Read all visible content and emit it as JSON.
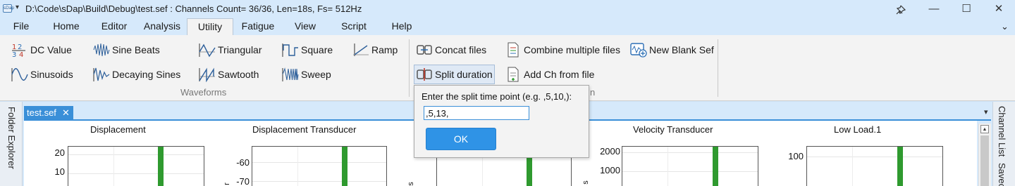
{
  "window": {
    "title": "D:\\Code\\sDap\\Build\\Debug\\test.sef : Channels Count= 36/36, Len=18s, Fs= 512Hz",
    "app_icon_text": "sDap",
    "menu_arrow": "▾",
    "pin_glyph": "⊥",
    "minimize_glyph": "—",
    "maximize_glyph": "☐",
    "close_glyph": "✕"
  },
  "menu": {
    "tabs": [
      {
        "label": "File"
      },
      {
        "label": "Home"
      },
      {
        "label": "Editor"
      },
      {
        "label": "Analysis"
      },
      {
        "label": "Utility",
        "active": true
      },
      {
        "label": "Fatigue"
      },
      {
        "label": "View"
      },
      {
        "label": "Script"
      },
      {
        "label": "Help"
      }
    ],
    "collapse_glyph": "⌄"
  },
  "ribbon": {
    "waveforms": {
      "group_label": "Waveforms",
      "items": [
        {
          "label": "DC Value",
          "icon": "fraction-icon"
        },
        {
          "label": "Sine Beats",
          "icon": "sine-beats-icon"
        },
        {
          "label": "Triangular",
          "icon": "triangular-wave-icon"
        },
        {
          "label": "Square",
          "icon": "square-wave-icon"
        },
        {
          "label": "Ramp",
          "icon": "ramp-icon"
        },
        {
          "label": "Sinusoids",
          "icon": "sinusoid-icon"
        },
        {
          "label": "Decaying Sines",
          "icon": "decaying-sine-icon"
        },
        {
          "label": "Sawtooth",
          "icon": "sawtooth-icon"
        },
        {
          "label": "Sweep",
          "icon": "sweep-icon"
        }
      ]
    },
    "files": {
      "group_label_partial": "n",
      "items": [
        {
          "label": "Concat files",
          "icon": "concat-icon"
        },
        {
          "label": "Combine multiple files",
          "icon": "combine-files-icon"
        },
        {
          "label": "New Blank Sef",
          "icon": "new-blank-icon"
        },
        {
          "label": "Split duration",
          "icon": "split-icon",
          "pressed": true
        },
        {
          "label": "Add Ch from file",
          "icon": "add-channel-icon"
        }
      ]
    }
  },
  "side_panels": {
    "left": "Folder Explorer",
    "right_top": "Channel List",
    "right_bottom": "Savec"
  },
  "document": {
    "tab_label": "test.sef",
    "tab_close": "✕",
    "dropdown_glyph": "▾",
    "scroll_up": "▲",
    "plots": [
      {
        "title": "Displacement",
        "yticks": [
          "20",
          "10"
        ],
        "ylabel": ""
      },
      {
        "title": "Displacement Transducer",
        "yticks": [
          "-60",
          "-70"
        ],
        "ylabel": "r"
      },
      {
        "title": "",
        "yticks": [],
        "ylabel": "s"
      },
      {
        "title": "Velocity Transducer",
        "yticks": [
          "2000",
          "1000"
        ],
        "ylabel": "s"
      },
      {
        "title": "Low Load.1",
        "yticks": [
          "100"
        ],
        "ylabel": ""
      }
    ]
  },
  "dialog": {
    "prompt": "Enter the split time point (e.g. ,5,10,):",
    "input_value": ",5,13,",
    "ok_label": "OK"
  },
  "colors": {
    "accent": "#3a8fd8",
    "ok_button": "#2f93e6",
    "signal": "#2f9a2f",
    "titlebar": "#d6e9fb"
  }
}
